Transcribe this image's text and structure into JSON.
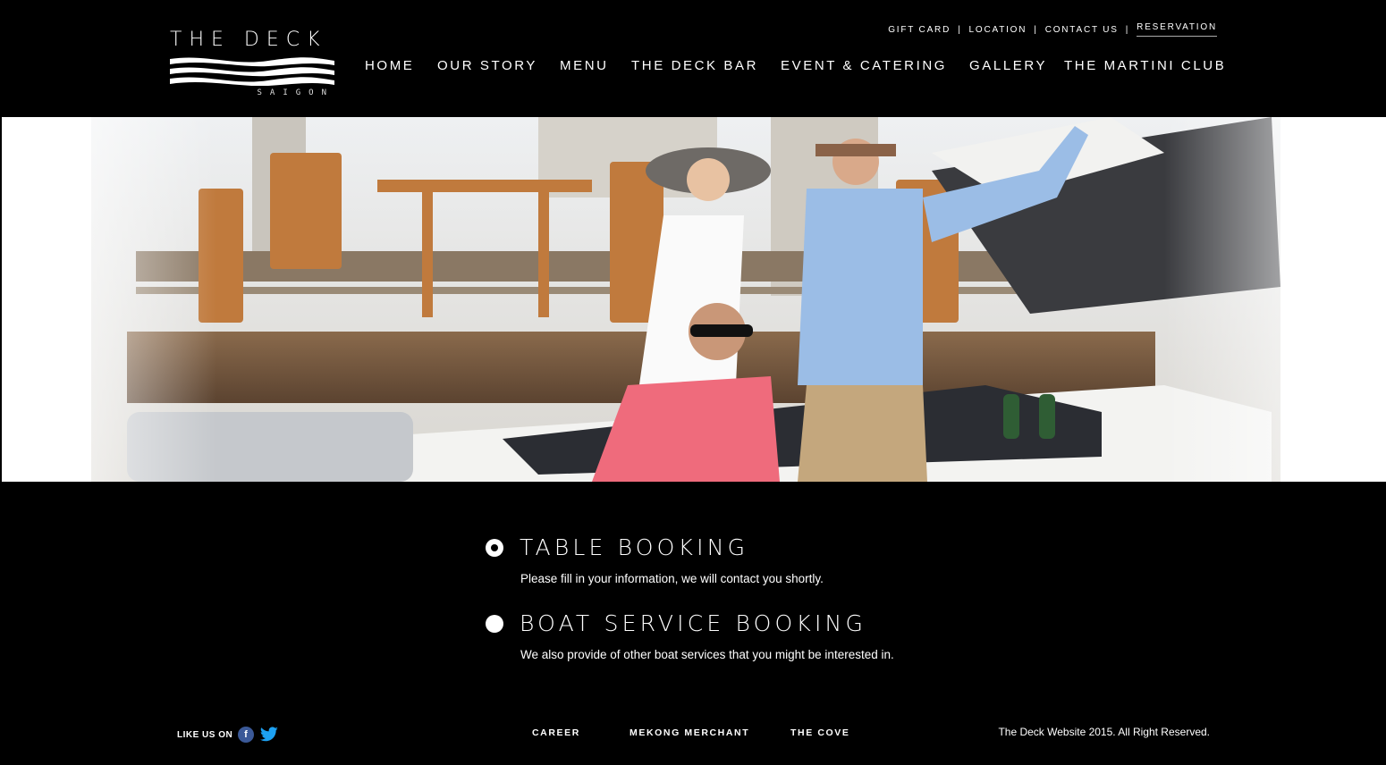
{
  "brand": {
    "name": "THE DECK",
    "subtitle": "SAIGON"
  },
  "top_nav": [
    {
      "label": "GIFT CARD"
    },
    {
      "label": "LOCATION"
    },
    {
      "label": "CONTACT US"
    },
    {
      "label": "RESERVATION",
      "active": true
    }
  ],
  "separator": "|",
  "main_nav": [
    {
      "label": "HOME"
    },
    {
      "label": "OUR STORY"
    },
    {
      "label": "MENU"
    },
    {
      "label": "THE DECK BAR"
    },
    {
      "label": "EVENT & CATERING"
    },
    {
      "label": "GALLERY"
    },
    {
      "label": "THE MARTINI CLUB"
    }
  ],
  "booking": {
    "selected": "table",
    "options": [
      {
        "id": "table",
        "title": "TABLE BOOKING",
        "description": "Please fill in your information, we will contact you shortly.",
        "checked": true
      },
      {
        "id": "boat",
        "title": "BOAT SERVICE BOOKING",
        "description": "We also provide of other boat services that you might be interested in.",
        "checked": false
      }
    ]
  },
  "footer": {
    "like_label": "LIKE US ON",
    "social_icons": [
      "facebook-icon",
      "twitter-icon"
    ],
    "facebook_glyph": "f",
    "links": [
      {
        "label": "CAREER"
      },
      {
        "label": "MEKONG MERCHANT"
      },
      {
        "label": "THE COVE"
      }
    ],
    "copyright": "The Deck Website 2015. All Right Reserved."
  },
  "colors": {
    "background": "#000000",
    "text": "#ffffff",
    "facebook": "#3b5998",
    "twitter": "#1da1f2"
  }
}
